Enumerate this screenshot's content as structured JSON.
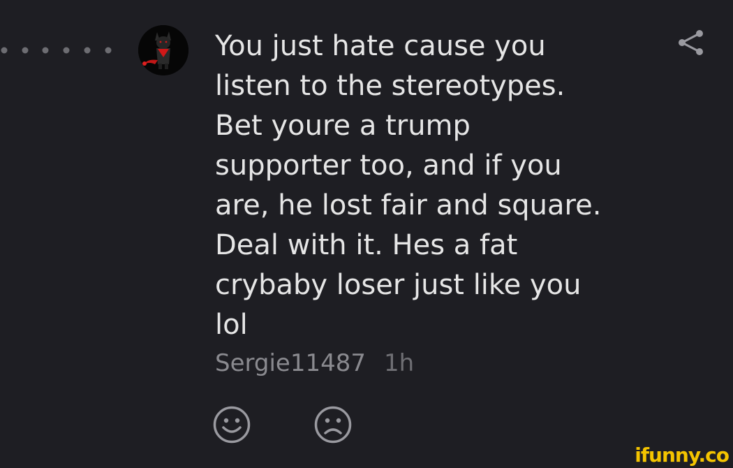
{
  "comment": {
    "text": "You just hate cause you\nlisten to the stereotypes.\nBet youre a trump\nsupporter too, and if you\nare, he lost fair and square.\nDeal with it. Hes a fat\ncrybaby loser just like you\nlol",
    "username": "Sergie11487",
    "timestamp": "1h"
  },
  "icons": {
    "share": "share-icon",
    "smile": "smile-reaction-icon",
    "frown": "frown-reaction-icon",
    "thread": "thread-dots-icon"
  },
  "watermark": "ifunny.co",
  "colors": {
    "background": "#1e1e23",
    "text": "#e6e6e6",
    "meta": "#8a8a8f",
    "icon": "#9a9aa0",
    "watermark": "#f4c400"
  }
}
